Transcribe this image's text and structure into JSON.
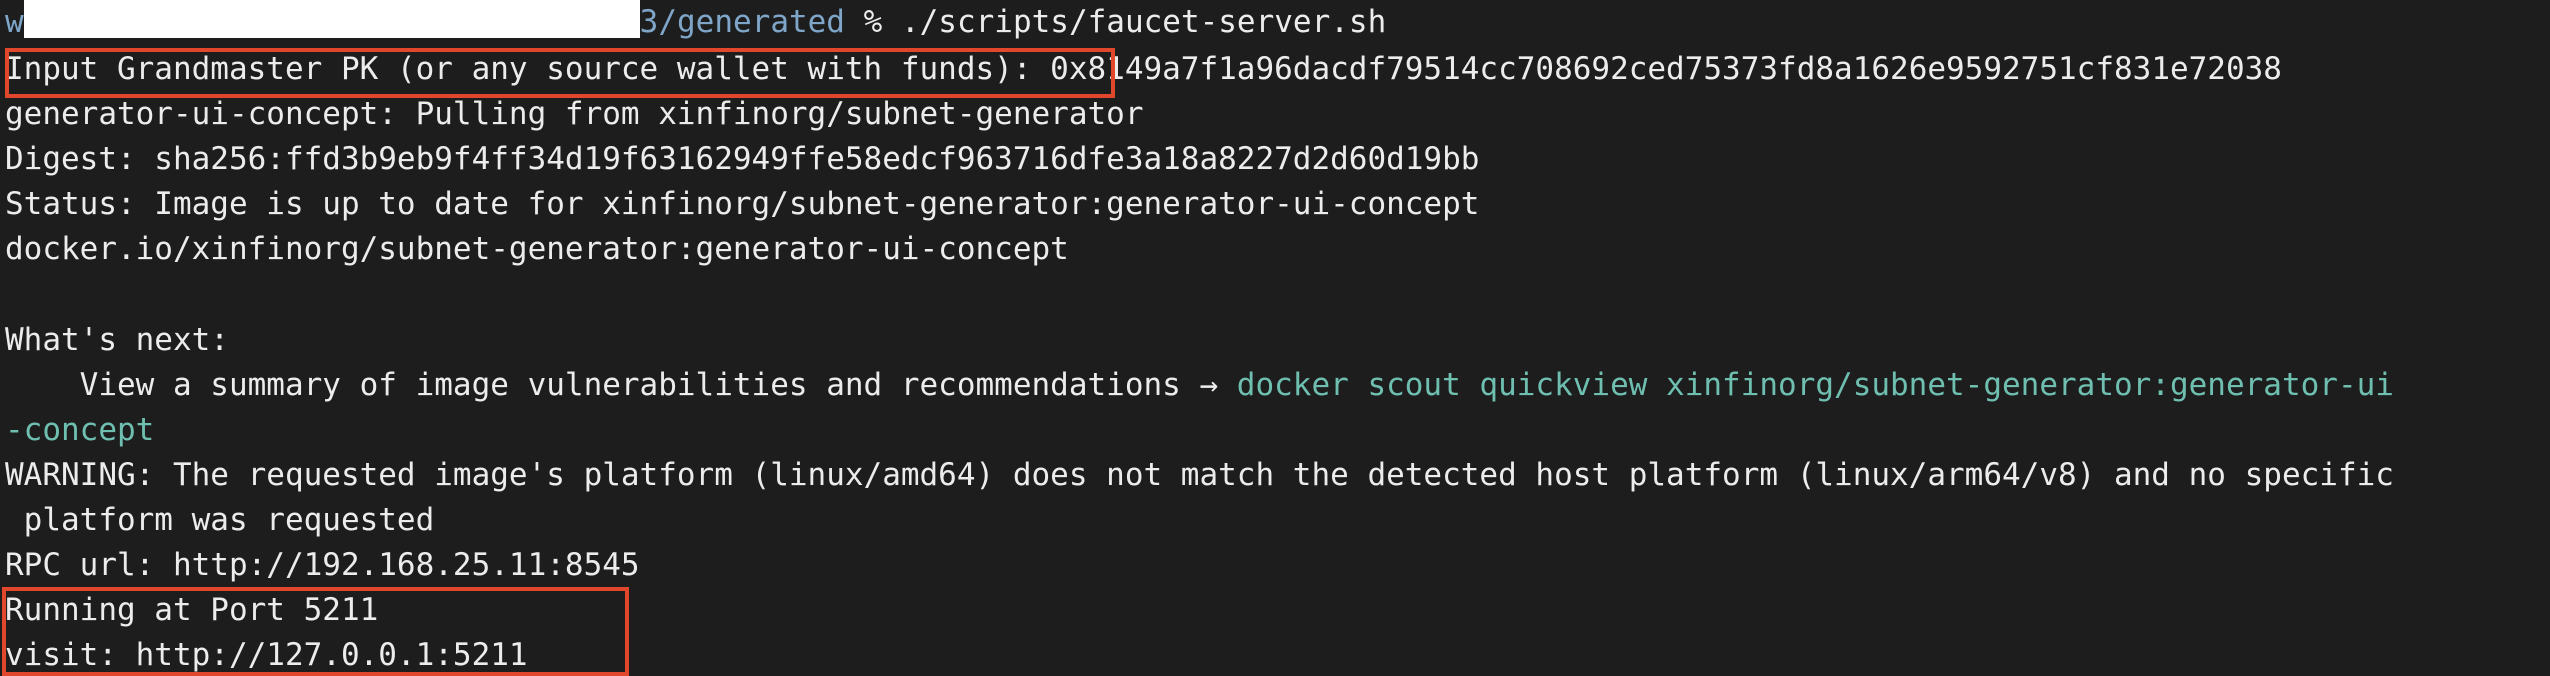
{
  "terminal": {
    "prompt": {
      "user_initial": "w",
      "path_suffix": "3/generated",
      "symbol": " % ",
      "command": "./scripts/faucet-server.sh"
    },
    "lines": {
      "input_prompt": "Input Grandmaster PK (or any source wallet with funds):",
      "input_value": " 0x8149a7f1a96dacdf79514cc708692ced75373fd8a1626e9592751cf831e72038",
      "pull": "generator-ui-concept: Pulling from xinfinorg/subnet-generator",
      "digest": "Digest: sha256:ffd3b9eb9f4ff34d19f63162949ffe58edcf963716dfe3a18a8227d2d60d19bb",
      "status": "Status: Image is up to date for xinfinorg/subnet-generator:generator-ui-concept",
      "image_ref": "docker.io/xinfinorg/subnet-generator:generator-ui-concept",
      "whats_next": "What's next:",
      "view_summary_text": "    View a summary of image vulnerabilities and recommendations → ",
      "view_summary_cmd": "docker scout quickview xinfinorg/subnet-generator:generator-ui",
      "view_summary_cont": "-concept",
      "warning": "WARNING: The requested image's platform (linux/amd64) does not match the detected host platform (linux/arm64/v8) and no specific",
      "warning_cont": " platform was requested",
      "rpc_url": "RPC url: http://192.168.25.11:8545",
      "running": "Running at Port 5211",
      "visit": "visit: http://127.0.0.1:5211"
    },
    "colors": {
      "background": "#1d1d1d",
      "text": "#ececec",
      "path": "#7fa6c9",
      "command_link": "#6fbfb0",
      "highlight_box": "#e0472c",
      "redaction": "#ffffff"
    }
  }
}
